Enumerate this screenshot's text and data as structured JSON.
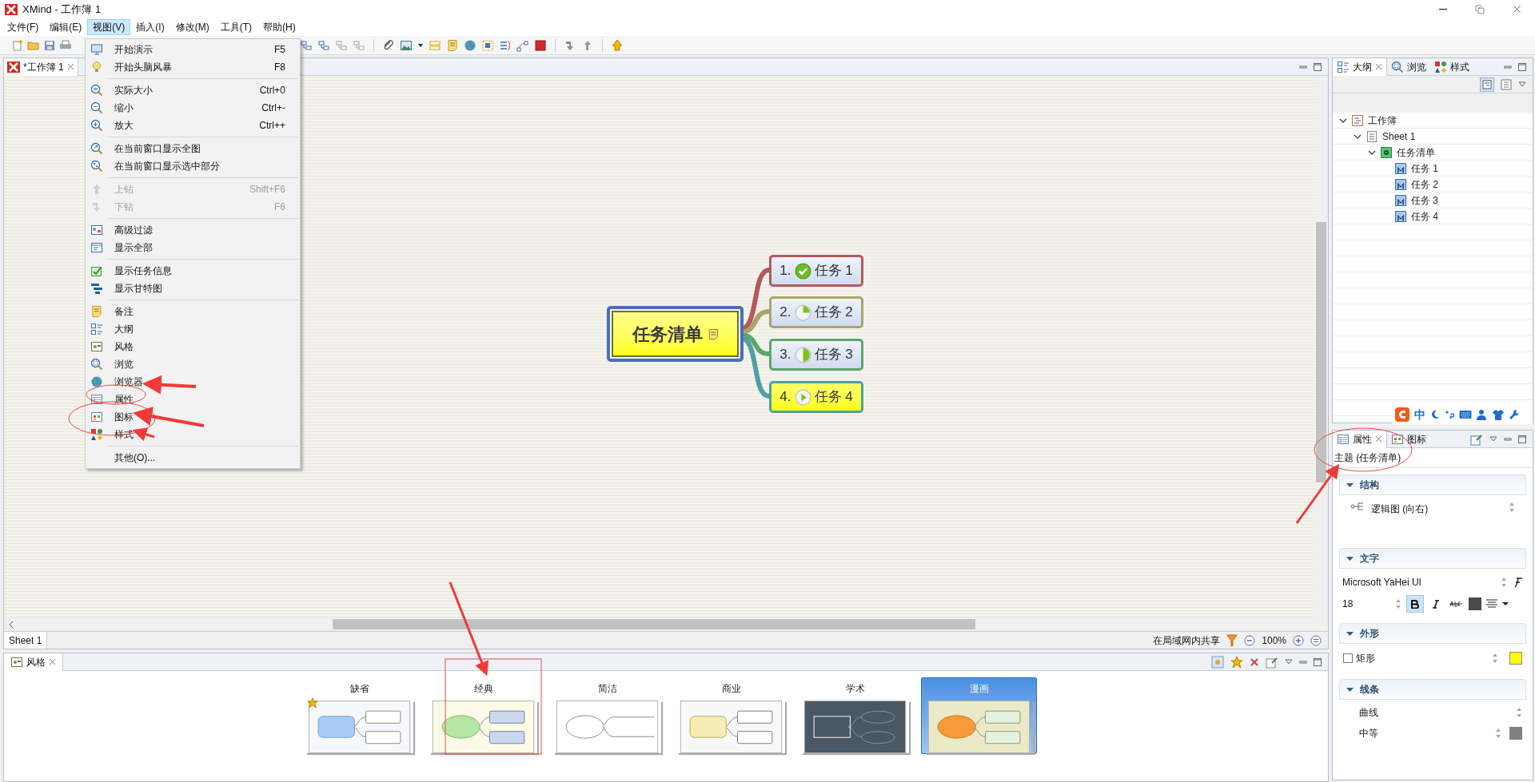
{
  "window": {
    "title": "XMind - 工作簿 1"
  },
  "menu_bar": [
    {
      "label": "文件(F)",
      "selected": false
    },
    {
      "label": "编辑(E)",
      "selected": false
    },
    {
      "label": "视图(V)",
      "selected": true
    },
    {
      "label": "插入(I)",
      "selected": false
    },
    {
      "label": "修改(M)",
      "selected": false
    },
    {
      "label": "工具(T)",
      "selected": false
    },
    {
      "label": "帮助(H)",
      "selected": false
    }
  ],
  "view_menu": {
    "groups": [
      {
        "items": [
          {
            "label": "开始演示",
            "shortcut": "F5",
            "disabled": false
          },
          {
            "label": "开始头脑风暴",
            "shortcut": "F8",
            "disabled": false
          }
        ]
      },
      {
        "items": [
          {
            "label": "实际大小",
            "shortcut": "Ctrl+0",
            "disabled": false
          },
          {
            "label": "缩小",
            "shortcut": "Ctrl+-",
            "disabled": false
          },
          {
            "label": "放大",
            "shortcut": "Ctrl++",
            "disabled": false
          }
        ]
      },
      {
        "items": [
          {
            "label": "在当前窗口显示全图",
            "disabled": false
          },
          {
            "label": "在当前窗口显示选中部分",
            "disabled": false
          }
        ]
      },
      {
        "items": [
          {
            "label": "上钻",
            "shortcut": "Shift+F6",
            "disabled": true
          },
          {
            "label": "下钻",
            "shortcut": "F6",
            "disabled": true
          }
        ]
      },
      {
        "items": [
          {
            "label": "高级过滤",
            "disabled": false
          },
          {
            "label": "显示全部",
            "disabled": false
          }
        ]
      },
      {
        "items": [
          {
            "label": "显示任务信息",
            "disabled": false
          },
          {
            "label": "显示甘特图",
            "disabled": false
          }
        ]
      },
      {
        "items": [
          {
            "label": "备注",
            "disabled": false
          },
          {
            "label": "大纲",
            "disabled": false
          },
          {
            "label": "风格",
            "disabled": false
          },
          {
            "label": "浏览",
            "disabled": false
          },
          {
            "label": "浏览器",
            "disabled": false
          },
          {
            "label": "属性",
            "disabled": false
          },
          {
            "label": "图标",
            "disabled": false
          },
          {
            "label": "样式",
            "disabled": false
          }
        ]
      },
      {
        "items": [
          {
            "label": "其他(O)...",
            "disabled": false
          }
        ]
      }
    ]
  },
  "editor_tab": {
    "label": "*工作簿 1"
  },
  "mind_map": {
    "central": {
      "label": "任务清单"
    },
    "topics": [
      {
        "number": "1.",
        "label": "任务 1",
        "kind": "done",
        "color": "#b5595b",
        "highlighted": false
      },
      {
        "number": "2.",
        "label": "任务 2",
        "kind": "quarter",
        "color": "#a9a56a",
        "highlighted": false
      },
      {
        "number": "3.",
        "label": "任务 3",
        "kind": "half",
        "color": "#5ea56d",
        "highlighted": false
      },
      {
        "number": "4.",
        "label": "任务 4",
        "kind": "start",
        "color": "#4ea0a6",
        "highlighted": true
      }
    ]
  },
  "sheet_bar": {
    "tab": "Sheet 1",
    "share": "在局域网内共享",
    "zoom": "100%"
  },
  "outline_panel": {
    "tabs": [
      {
        "label": "大纲",
        "selected": true
      },
      {
        "label": "浏览",
        "selected": false
      },
      {
        "label": "样式",
        "selected": false
      }
    ],
    "tree": [
      {
        "label": "工作簿",
        "kind": "workbook",
        "expanded": true,
        "children": [
          {
            "label": "Sheet 1",
            "kind": "sheet",
            "expanded": true,
            "children": [
              {
                "label": "任务清单",
                "kind": "central",
                "expanded": true,
                "children": [
                  {
                    "label": "任务 1",
                    "kind": "main"
                  },
                  {
                    "label": "任务 2",
                    "kind": "main"
                  },
                  {
                    "label": "任务 3",
                    "kind": "main"
                  },
                  {
                    "label": "任务 4",
                    "kind": "main"
                  }
                ]
              }
            ]
          }
        ]
      }
    ]
  },
  "ime_bar": {
    "mode": "中"
  },
  "properties_panel": {
    "tabs": [
      {
        "label": "属性",
        "selected": true
      },
      {
        "label": "图标",
        "selected": false
      }
    ],
    "subject": "主题 (任务清单)",
    "structure": {
      "title": "结构",
      "expanded": true,
      "value": "逻辑图 (向右)"
    },
    "text": {
      "title": "文字",
      "expanded": true,
      "font": "Microsoft YaHei UI",
      "size": "18",
      "bold": true,
      "italic": false,
      "strikethrough": false,
      "color": "#4a4a4a"
    },
    "shape": {
      "title": "外形",
      "expanded": true,
      "value": "矩形",
      "color": "#ffff00"
    },
    "line": {
      "title": "线条",
      "expanded": true,
      "value": "曲线",
      "width": "中等",
      "color": "#808080"
    }
  },
  "styles_panel": {
    "tab": "风格",
    "styles": [
      {
        "label": "缺省",
        "kind": "default",
        "starred": true,
        "selected": false
      },
      {
        "label": "经典",
        "kind": "classic",
        "starred": false,
        "selected": false
      },
      {
        "label": "简洁",
        "kind": "simple",
        "starred": false,
        "selected": false
      },
      {
        "label": "商业",
        "kind": "business",
        "starred": false,
        "selected": false
      },
      {
        "label": "学术",
        "kind": "academic",
        "starred": false,
        "selected": false
      },
      {
        "label": "漫画",
        "kind": "comic",
        "starred": false,
        "selected": true
      }
    ]
  }
}
